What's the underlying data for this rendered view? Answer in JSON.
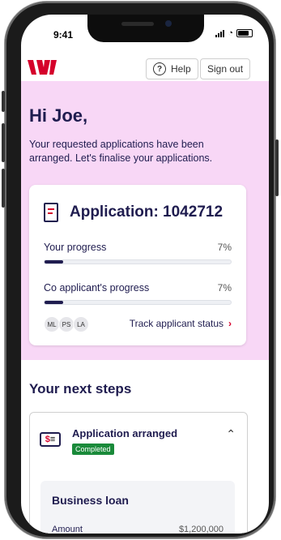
{
  "status": {
    "time": "9:41"
  },
  "header": {
    "help_label": "Help",
    "signout_label": "Sign out"
  },
  "hero": {
    "greeting": "Hi Joe,",
    "intro": "Your requested applications have been arranged. Let's finalise your applications."
  },
  "application": {
    "title": "Application: 1042712",
    "your_progress_label": "Your progress",
    "your_progress_pct": "7%",
    "your_progress_value": 0.07,
    "co_progress_label": "Co applicant's progress",
    "co_progress_pct": "7%",
    "co_progress_value": 0.07,
    "avatars": [
      "ML",
      "PS",
      "LA"
    ],
    "track_label": "Track applicant status"
  },
  "next_steps": {
    "title": "Your next steps",
    "step_title": "Application arranged",
    "step_badge": "Completed",
    "loan_title": "Business loan",
    "amount_label": "Amount",
    "amount_value": "$1,200,000"
  },
  "colors": {
    "brand_red": "#d5002b",
    "navy": "#1f1c4f",
    "hero_bg": "#f8d7f6",
    "success": "#1a8a3a"
  }
}
